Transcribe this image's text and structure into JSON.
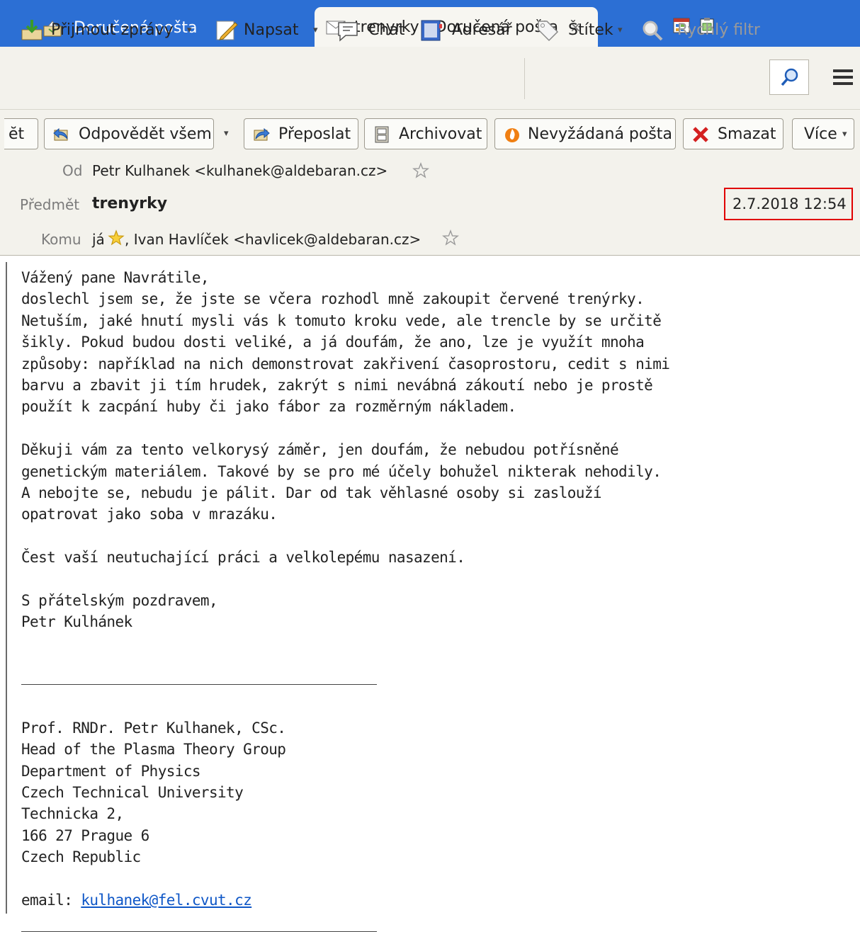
{
  "tabs": [
    {
      "label": "Doručená pošta",
      "icon": "inbox-icon"
    },
    {
      "label": "trenyrky - Doručená pošta",
      "icon": "envelope-icon",
      "close": "×"
    }
  ],
  "toolbar": {
    "get_messages": "Přijmout zprávy",
    "write": "Napsat",
    "chat": "Chat",
    "address_book": "Adresář",
    "tag": "Štítek",
    "quick_filter": "Rychlý filtr",
    "dropdown_glyph": "▾"
  },
  "actions": {
    "reply_partial": "ĕt",
    "reply_all": "Odpovědět všem",
    "forward": "Přeposlat",
    "archive": "Archivovat",
    "junk": "Nevyžádaná pošta",
    "delete": "Smazat",
    "more": "Více"
  },
  "header": {
    "from_label": "Od",
    "from_value": "Petr Kulhanek <kulhanek@aldebaran.cz>",
    "subject_label": "Předmět",
    "subject_value": "trenyrky",
    "date": "2.7.2018 12:54",
    "to_label": "Komu",
    "to_me": "já",
    "to_others": ", Ivan Havlíček <havlicek@aldebaran.cz>"
  },
  "body": {
    "paragraph1": "Vážený pane Navrátile,\ndoslechl jsem se, že jste se včera rozhodl mně zakoupit červené trenýrky.\nNetuším, jaké hnutí mysli vás k tomuto kroku vede, ale trencle by se určitě\nšikly. Pokud budou dosti veliké, a já doufám, že ano, lze je využít mnoha\nzpůsoby: například na nich demonstrovat zakřivení časoprostoru, cedit s nimi\nbarvu a zbavit ji tím hrudek, zakrýt s nimi nevábná zákoutí nebo je prostě\npoužít k zacpání huby či jako fábor za rozměrným nákladem.",
    "paragraph2": "Děkuji vám za tento velkorysý záměr, jen doufám, že nebudou potřísněné\ngenetickým materiálem. Takové by se pro mé účely bohužel nikterak nehodily.\nA nebojte se, nebudu je pálit. Dar od tak věhlasné osoby si zaslouží\nopatrovat jako soba v mrazáku.",
    "paragraph3": "Čest vaší neutuchající práci a velkolepému nasazení.",
    "closing": "S přátelským pozdravem,\nPetr Kulhánek",
    "signature": "Prof. RNDr. Petr Kulhanek, CSc.\nHead of the Plasma Theory Group\nDepartment of Physics\nCzech Technical University\nTechnicka 2,\n166 27 Prague 6\nCzech Republic",
    "email_label": "email: ",
    "email_link": "kulhanek@fel.cvut.cz"
  },
  "colors": {
    "tabbar": "#2c6fd4",
    "toolbar": "#f3f2ec",
    "date_highlight": "#e00000",
    "link": "#0f57c7"
  }
}
